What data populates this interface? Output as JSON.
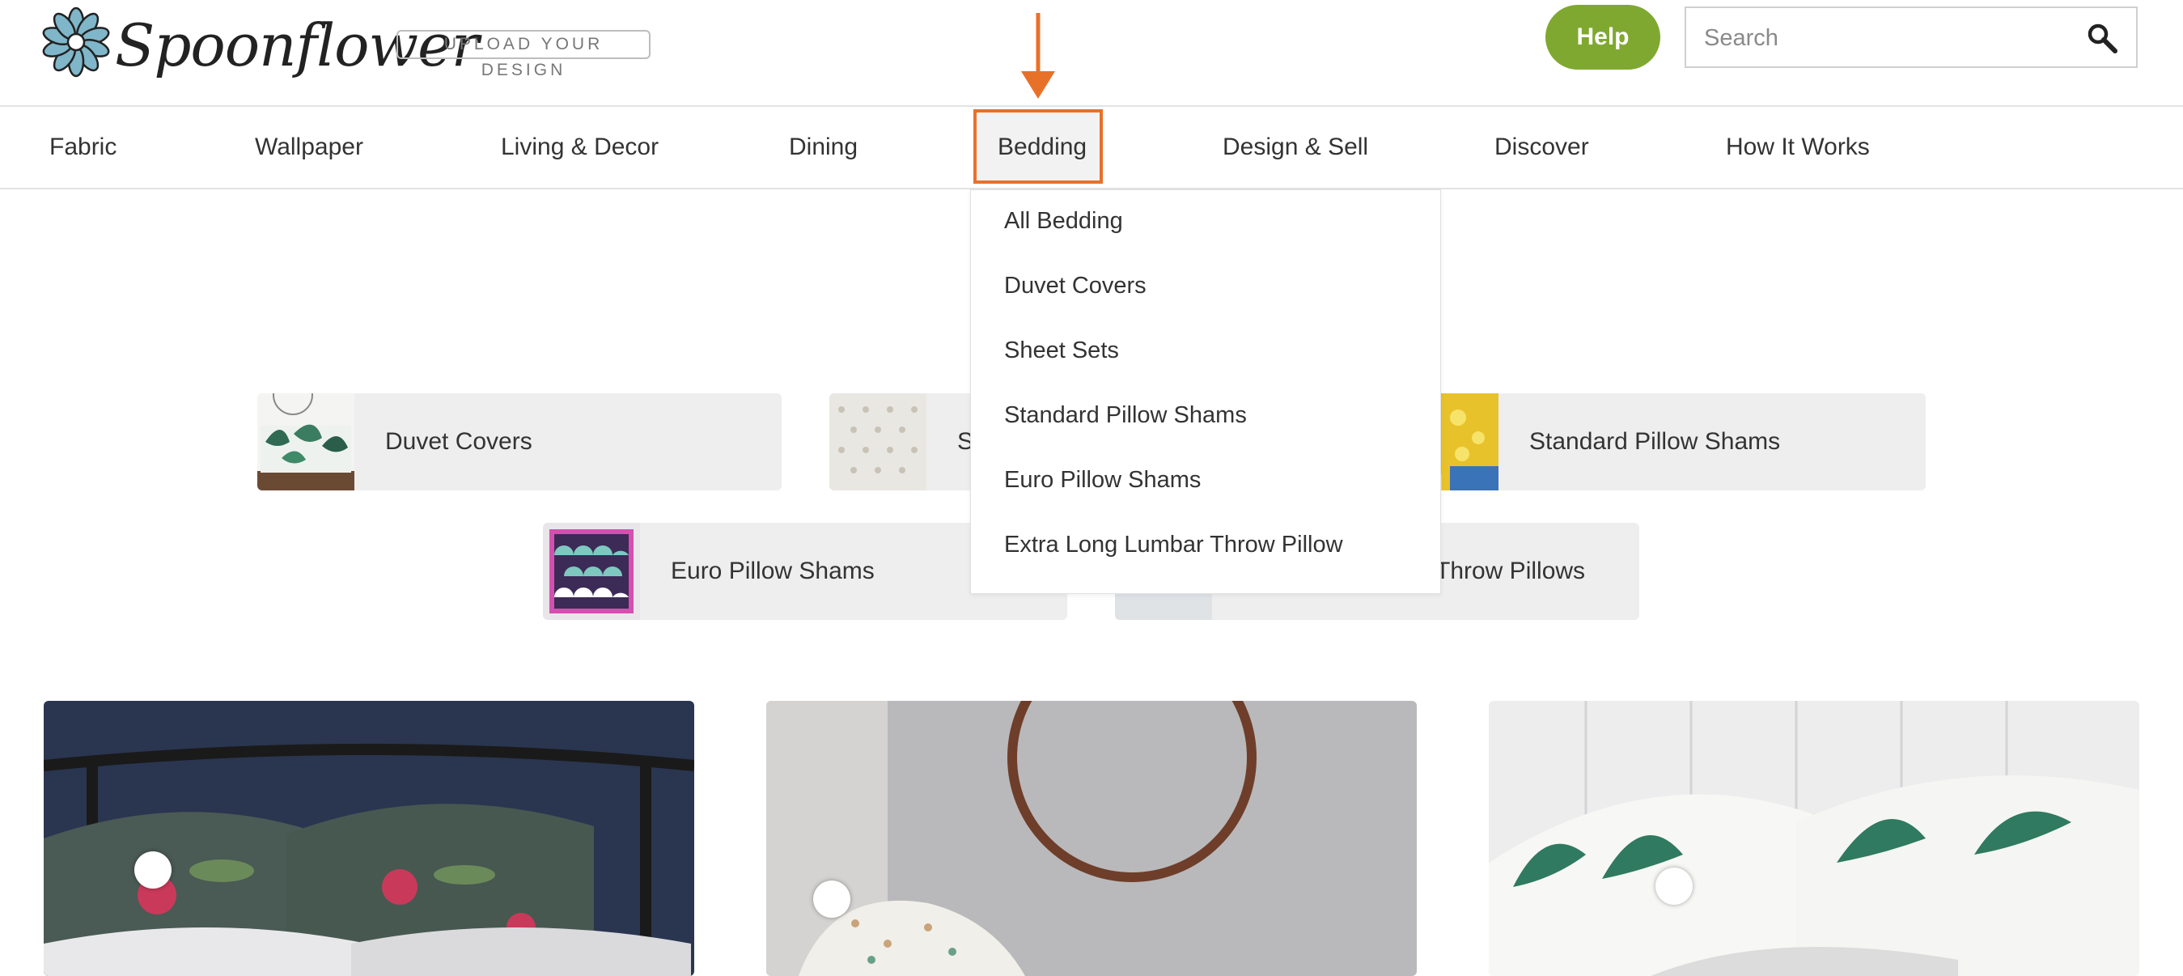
{
  "brand": {
    "name": "Spoonflower"
  },
  "header": {
    "upload_label": "UPLOAD YOUR DESIGN",
    "help_label": "Help",
    "search_placeholder": "Search"
  },
  "nav": {
    "items": [
      "Fabric",
      "Wallpaper",
      "Living & Decor",
      "Dining",
      "Bedding",
      "Design & Sell",
      "Discover",
      "How It Works"
    ],
    "active": "Bedding"
  },
  "dropdown": {
    "items": [
      "All Bedding",
      "Duvet Covers",
      "Sheet Sets",
      "Standard Pillow Shams",
      "Euro Pillow Shams",
      "Extra Long Lumbar Throw Pillow"
    ]
  },
  "categories": {
    "row1": [
      "Duvet Covers",
      "S",
      "Standard Pillow Shams"
    ],
    "row2": [
      "Euro Pillow Shams",
      "Throw Pillows"
    ]
  },
  "colors": {
    "accent_green": "#7fa830",
    "highlight_orange": "#e8712a",
    "tile_bg": "#eeeeee"
  },
  "icons": [
    "flower-logo-icon",
    "search-icon",
    "arrow-down-icon"
  ]
}
